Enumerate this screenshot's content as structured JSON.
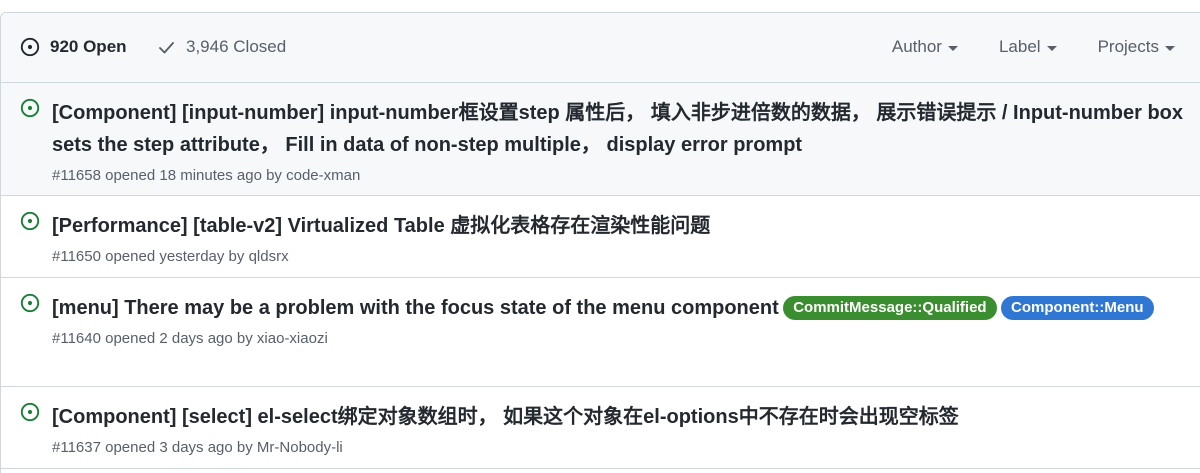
{
  "header": {
    "open_label": "920 Open",
    "closed_label": "3,946 Closed",
    "filters": [
      "Author",
      "Label",
      "Projects"
    ]
  },
  "issues": [
    {
      "title": "[Component] [input-number] input-number框设置step 属性后， 填入非步进倍数的数据， 展示错误提示 / Input-number box sets the step attribute， Fill in data of non-step multiple， display error prompt",
      "number": "#11658",
      "opened": "opened 18 minutes ago by",
      "author": "code-xman",
      "labels": []
    },
    {
      "title": "[Performance] [table-v2] Virtualized Table 虚拟化表格存在渲染性能问题",
      "number": "#11650",
      "opened": "opened yesterday by",
      "author": "qldsrx",
      "labels": []
    },
    {
      "title": "[menu] There may be a problem with the focus state of the menu component",
      "number": "#11640",
      "opened": "opened 2 days ago by",
      "author": "xiao-xiaozi",
      "labels": [
        {
          "text": "CommitMessage::Qualified",
          "color": "#3b8e2f"
        },
        {
          "text": "Component::Menu",
          "color": "#2f77d3"
        }
      ]
    },
    {
      "title": "[Component] [select] el-select绑定对象数组时， 如果这个对象在el-options中不存在时会出现空标签",
      "number": "#11637",
      "opened": "opened 3 days ago by",
      "author": "Mr-Nobody-li",
      "labels": []
    }
  ],
  "colors": {
    "open_icon": "#1a7f37",
    "header_bg": "#f6f8fa",
    "border": "#d0d7de",
    "muted_text": "#57606a"
  },
  "icons": {
    "open_state": "issue-opened-icon",
    "closed_state": "check-icon",
    "issue_status": "issue-opened-icon"
  }
}
